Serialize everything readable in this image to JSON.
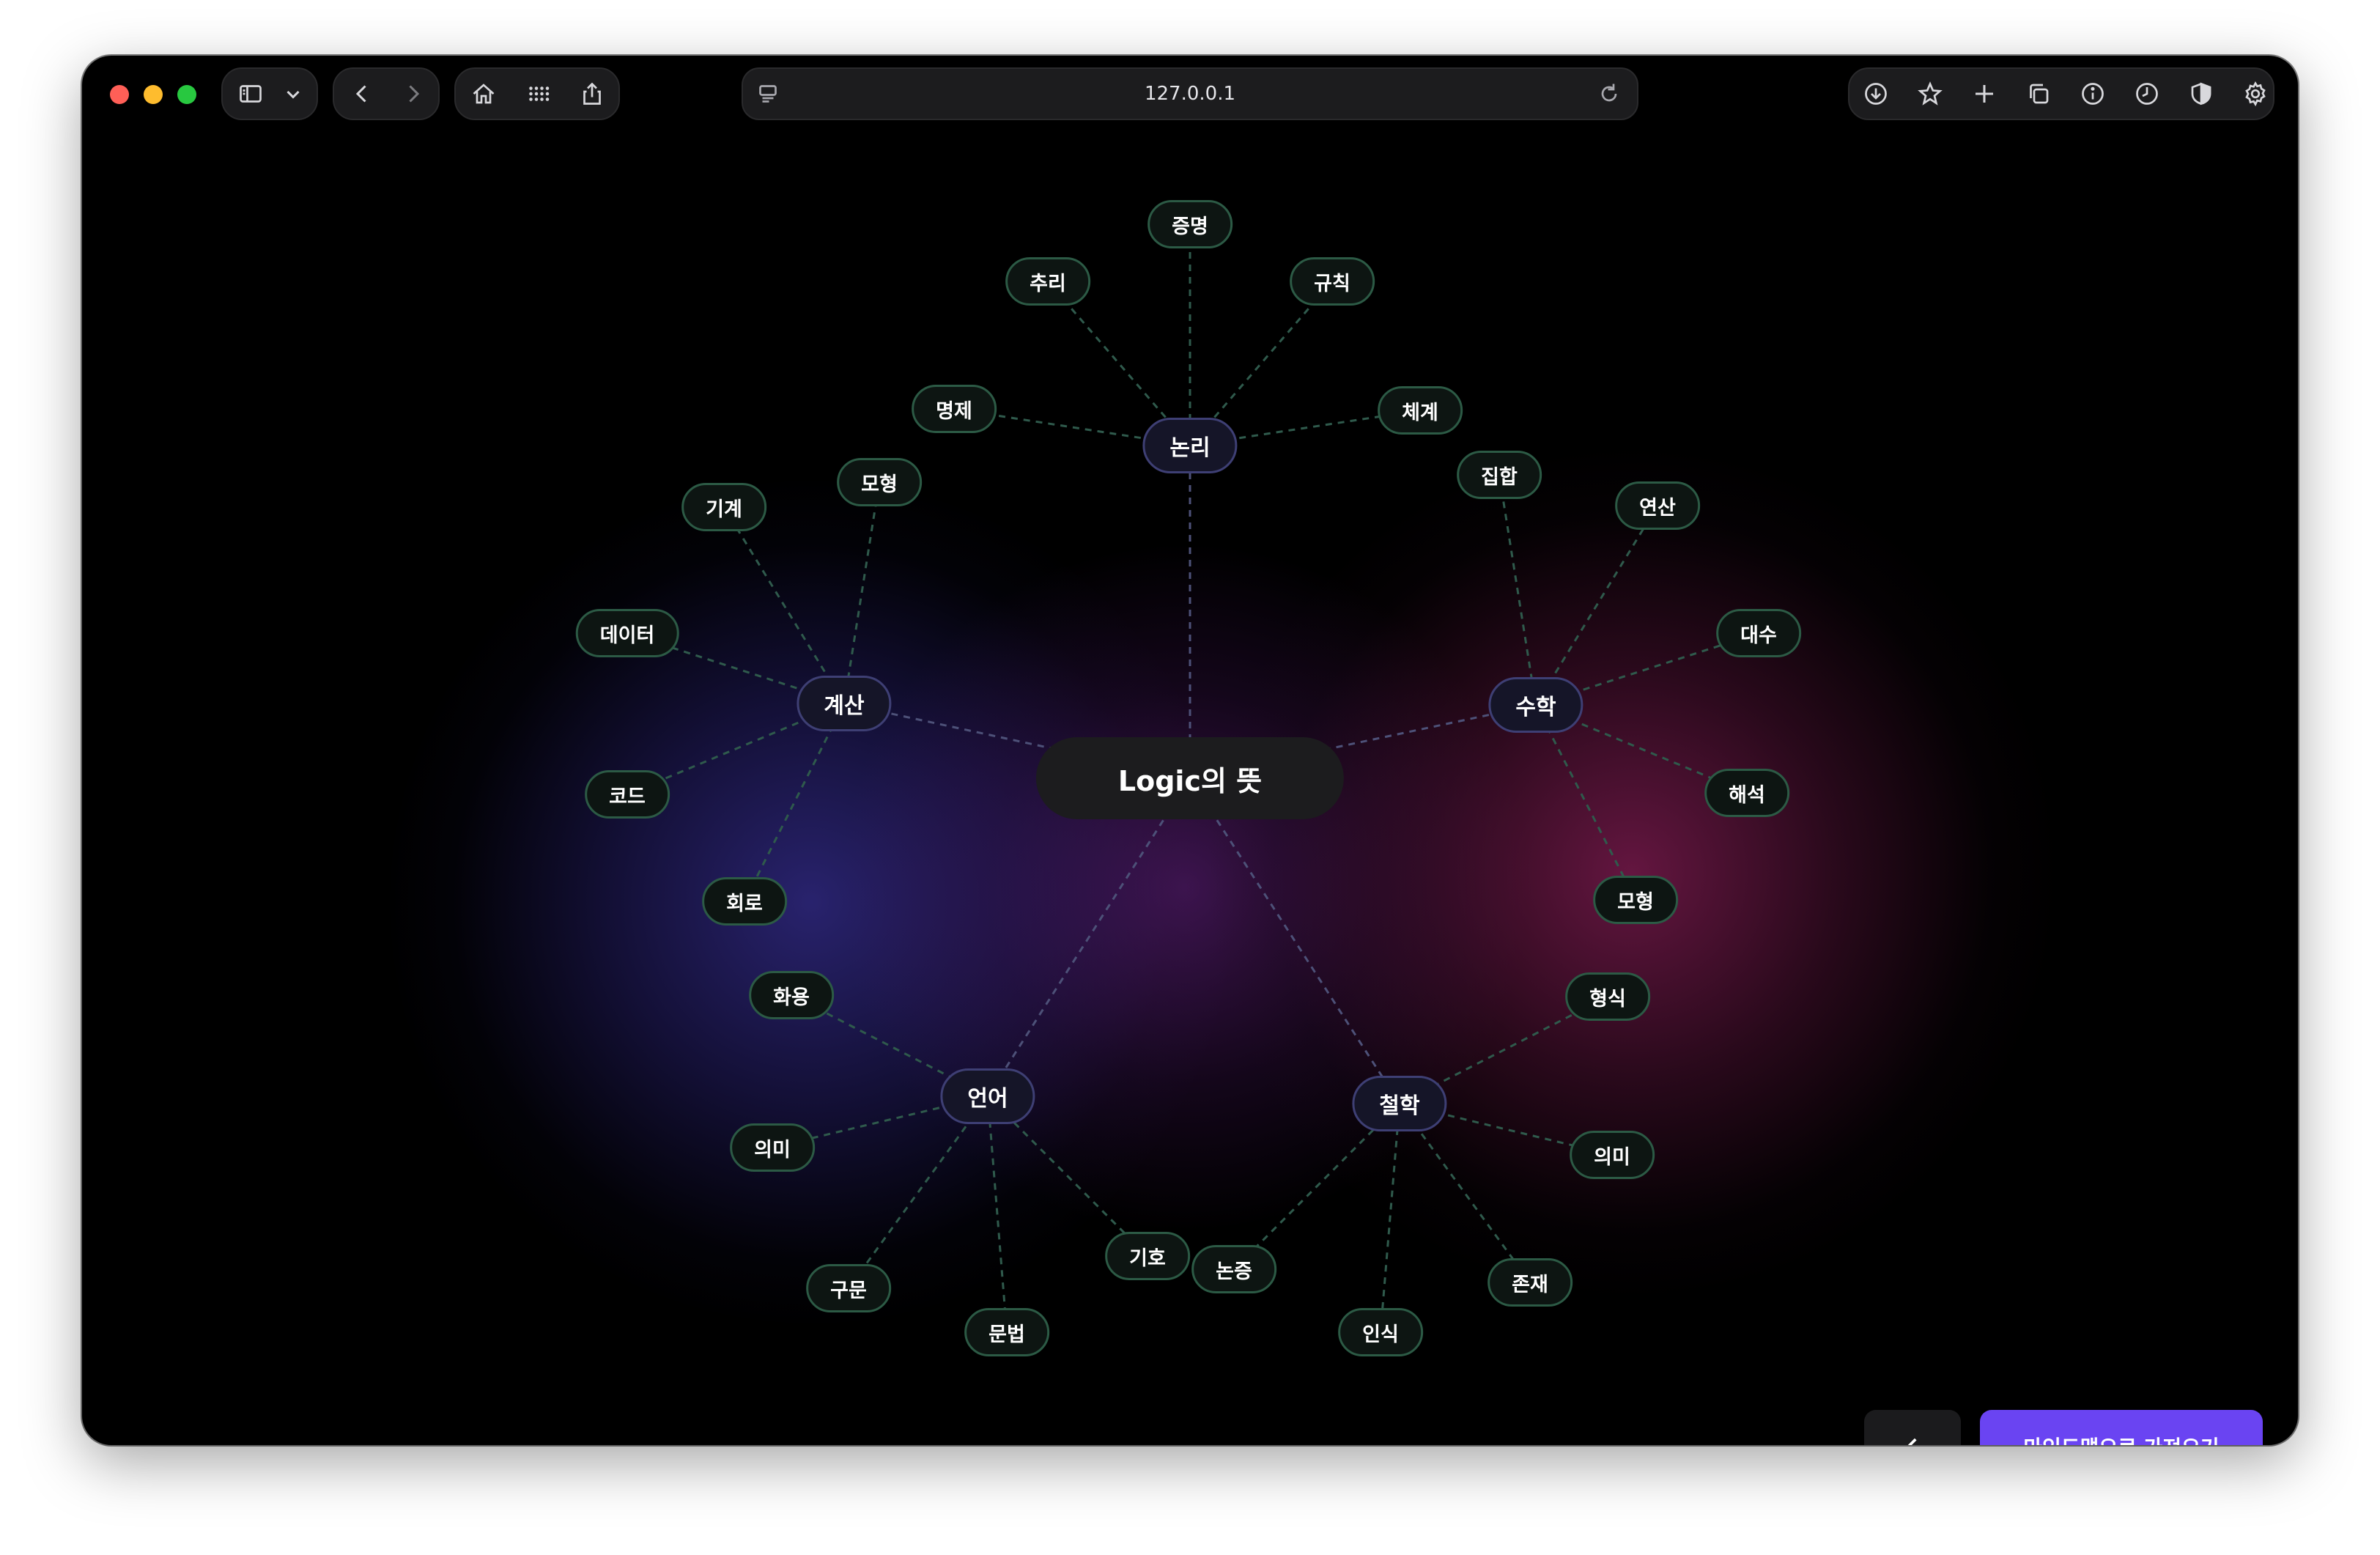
{
  "browser": {
    "url": "127.0.0.1",
    "icons": [
      "sidebar-icon",
      "chevron-down-icon",
      "back-icon",
      "forward-icon",
      "home-icon",
      "grid-icon",
      "share-icon",
      "page-icon",
      "reload-icon",
      "download-icon",
      "star-icon",
      "plus-icon",
      "tabs-icon",
      "info-icon",
      "clock-icon",
      "shield-icon",
      "gear-icon"
    ]
  },
  "mindmap": {
    "root": "Logic의 뜻",
    "branches": [
      {
        "label": "논리",
        "leaves": [
          "증명",
          "추리",
          "규칙",
          "명제",
          "체계"
        ]
      },
      {
        "label": "계산",
        "leaves": [
          "모형",
          "기계",
          "데이터",
          "코드",
          "회로"
        ]
      },
      {
        "label": "수학",
        "leaves": [
          "집합",
          "연산",
          "대수",
          "해석",
          "모형"
        ]
      },
      {
        "label": "언어",
        "leaves": [
          "화용",
          "의미",
          "구문",
          "문법",
          "기호"
        ]
      },
      {
        "label": "철학",
        "leaves": [
          "형식",
          "의미",
          "존재",
          "인식",
          "논증"
        ]
      }
    ]
  },
  "actions": {
    "back_icon": "chevron-left-icon",
    "import_label": "마인드맵으로 가져오기"
  },
  "colors": {
    "accent": "#6a44f2",
    "leaf_border": "#2c5a45",
    "branch_border": "#3e3f74",
    "link_branch": "#4d5178",
    "link_leaf": "#2f5a4c"
  }
}
